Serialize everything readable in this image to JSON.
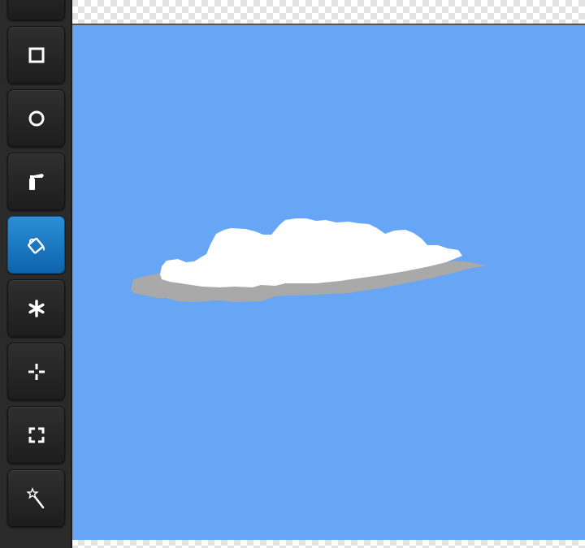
{
  "toolbar": {
    "tools": [
      {
        "name": "tool-partial",
        "icon": "unknown-icon",
        "active": false
      },
      {
        "name": "rectangle-tool",
        "icon": "square-icon",
        "active": false
      },
      {
        "name": "ellipse-tool",
        "icon": "circle-icon",
        "active": false
      },
      {
        "name": "spray-tool",
        "icon": "spray-can-icon",
        "active": false
      },
      {
        "name": "fill-tool",
        "icon": "paint-bucket-icon",
        "active": true
      },
      {
        "name": "stamp-tool",
        "icon": "asterisk-icon",
        "active": false
      },
      {
        "name": "move-tool",
        "icon": "move-crosshair-icon",
        "active": false
      },
      {
        "name": "select-tool",
        "icon": "selection-marquee-icon",
        "active": false
      },
      {
        "name": "magic-wand-tool",
        "icon": "magic-wand-icon",
        "active": false
      }
    ]
  },
  "canvas": {
    "background_color": "#66a6f5",
    "cloud_colors": {
      "top": "#ffffff",
      "shadow": "#a9a9a9"
    }
  },
  "colors": {
    "toolbar_bg": "#2a2a2a",
    "active_tool": "#1677c4"
  }
}
